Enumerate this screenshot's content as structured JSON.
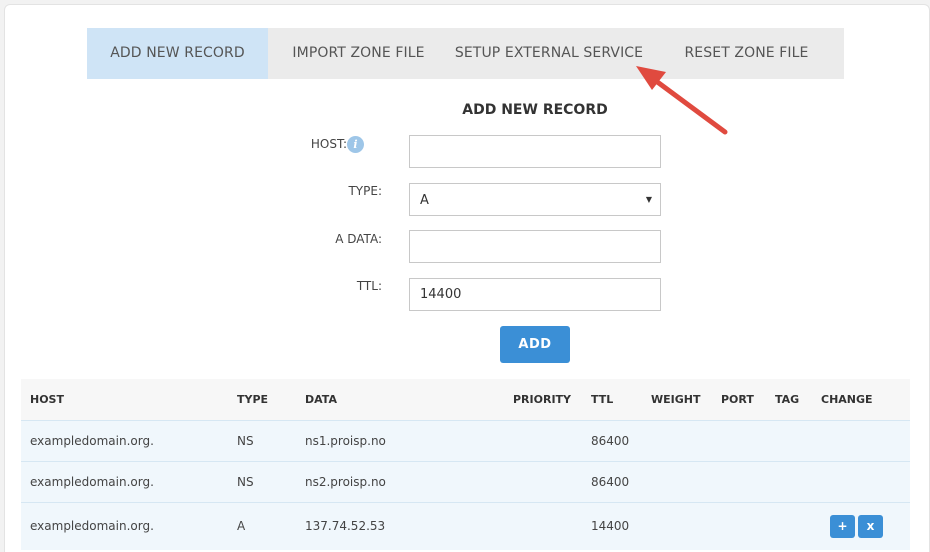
{
  "tabs": [
    {
      "label": "ADD NEW RECORD",
      "active": true
    },
    {
      "label": "IMPORT ZONE FILE",
      "active": false
    },
    {
      "label": "SETUP EXTERNAL SERVICE",
      "active": false
    },
    {
      "label": "RESET ZONE FILE",
      "active": false
    }
  ],
  "form": {
    "title": "ADD NEW RECORD",
    "host_label": "HOST:",
    "host_value": "",
    "type_label": "TYPE:",
    "type_value": "A",
    "adata_label": "A DATA:",
    "adata_value": "",
    "ttl_label": "TTL:",
    "ttl_value": "14400",
    "add_label": "ADD"
  },
  "table": {
    "headers": [
      "HOST",
      "TYPE",
      "DATA",
      "PRIORITY",
      "TTL",
      "WEIGHT",
      "PORT",
      "TAG",
      "CHANGE"
    ],
    "rows": [
      {
        "host": "exampledomain.org.",
        "type": "NS",
        "data": "ns1.proisp.no",
        "priority": "",
        "ttl": "86400",
        "weight": "",
        "port": "",
        "tag": ""
      },
      {
        "host": "exampledomain.org.",
        "type": "NS",
        "data": "ns2.proisp.no",
        "priority": "",
        "ttl": "86400",
        "weight": "",
        "port": "",
        "tag": ""
      },
      {
        "host": "exampledomain.org.",
        "type": "A",
        "data": "137.74.52.53",
        "priority": "",
        "ttl": "14400",
        "weight": "",
        "port": "",
        "tag": "",
        "edit_label": "+",
        "delete_label": "x"
      }
    ]
  },
  "colors": {
    "accent": "#3b8fd6",
    "active_tab": "#cfe4f6",
    "annotation_arrow": "#e04a3f"
  },
  "icons": {
    "info": "info-icon",
    "dropdown": "caret-down-icon",
    "annotation": "arrow-annotation"
  }
}
